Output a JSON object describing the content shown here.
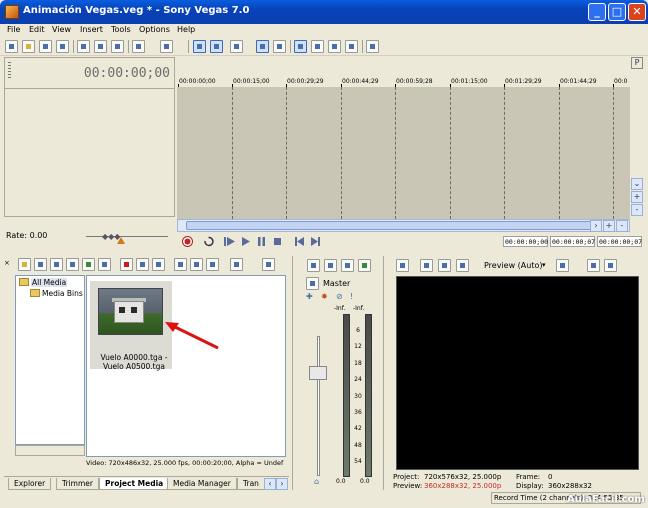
{
  "window": {
    "title": "Animación Vegas.veg * - Sony Vegas 7.0",
    "buttons": [
      "_",
      "□",
      "✕"
    ]
  },
  "menu": [
    "File",
    "Edit",
    "View",
    "Insert",
    "Tools",
    "Options",
    "Help"
  ],
  "timeline": {
    "timecode": "00:00:00;00",
    "ruler_labels": [
      "00:00:00;00",
      "00:00:15;00",
      "00:00:29;29",
      "00:00:44;29",
      "00:00:59;28",
      "00:01:15;00",
      "00:01:29;29",
      "00:01:44;29",
      "00:0"
    ],
    "rate_label": "Rate: 0.00",
    "cursor_start": "00:00:00;00",
    "cursor_end": "00:00:00;07",
    "length": "00:00:00;07"
  },
  "media": {
    "tree": [
      "All Media",
      "Media Bins"
    ],
    "item_caption": "Vuelo A0000.tga - Vuelo A0500.tga",
    "status": "Video: 720x486x32, 25.000 fps, 00:00:20;00, Alpha = Undef"
  },
  "tabs": [
    "Explorer",
    "Trimmer",
    "Project Media",
    "Media Manager",
    "Tran"
  ],
  "mixer": {
    "label": "Master",
    "inf_left": "-Inf.",
    "inf_right": "-Inf.",
    "scale": [
      "6",
      "12",
      "18",
      "24",
      "30",
      "36",
      "42",
      "48",
      "54"
    ],
    "bottom_left": "0.0",
    "bottom_right": "0.0"
  },
  "preview": {
    "mode": "Preview (Auto)",
    "project_label": "Project:",
    "project_value": "720x576x32, 25.000p",
    "preview_label": "Preview:",
    "preview_value": "360x288x32, 25.000p",
    "frame_label": "Frame:",
    "frame_value": "0",
    "display_label": "Display:",
    "display_value": "360x288x32"
  },
  "status": {
    "record_time": "Record Time (2 channels): 384:55:35"
  },
  "watermark": "AulaFacil.com",
  "colors": {
    "preview_value_red": "#cc2a2a",
    "arrow_red": "#e01010"
  }
}
